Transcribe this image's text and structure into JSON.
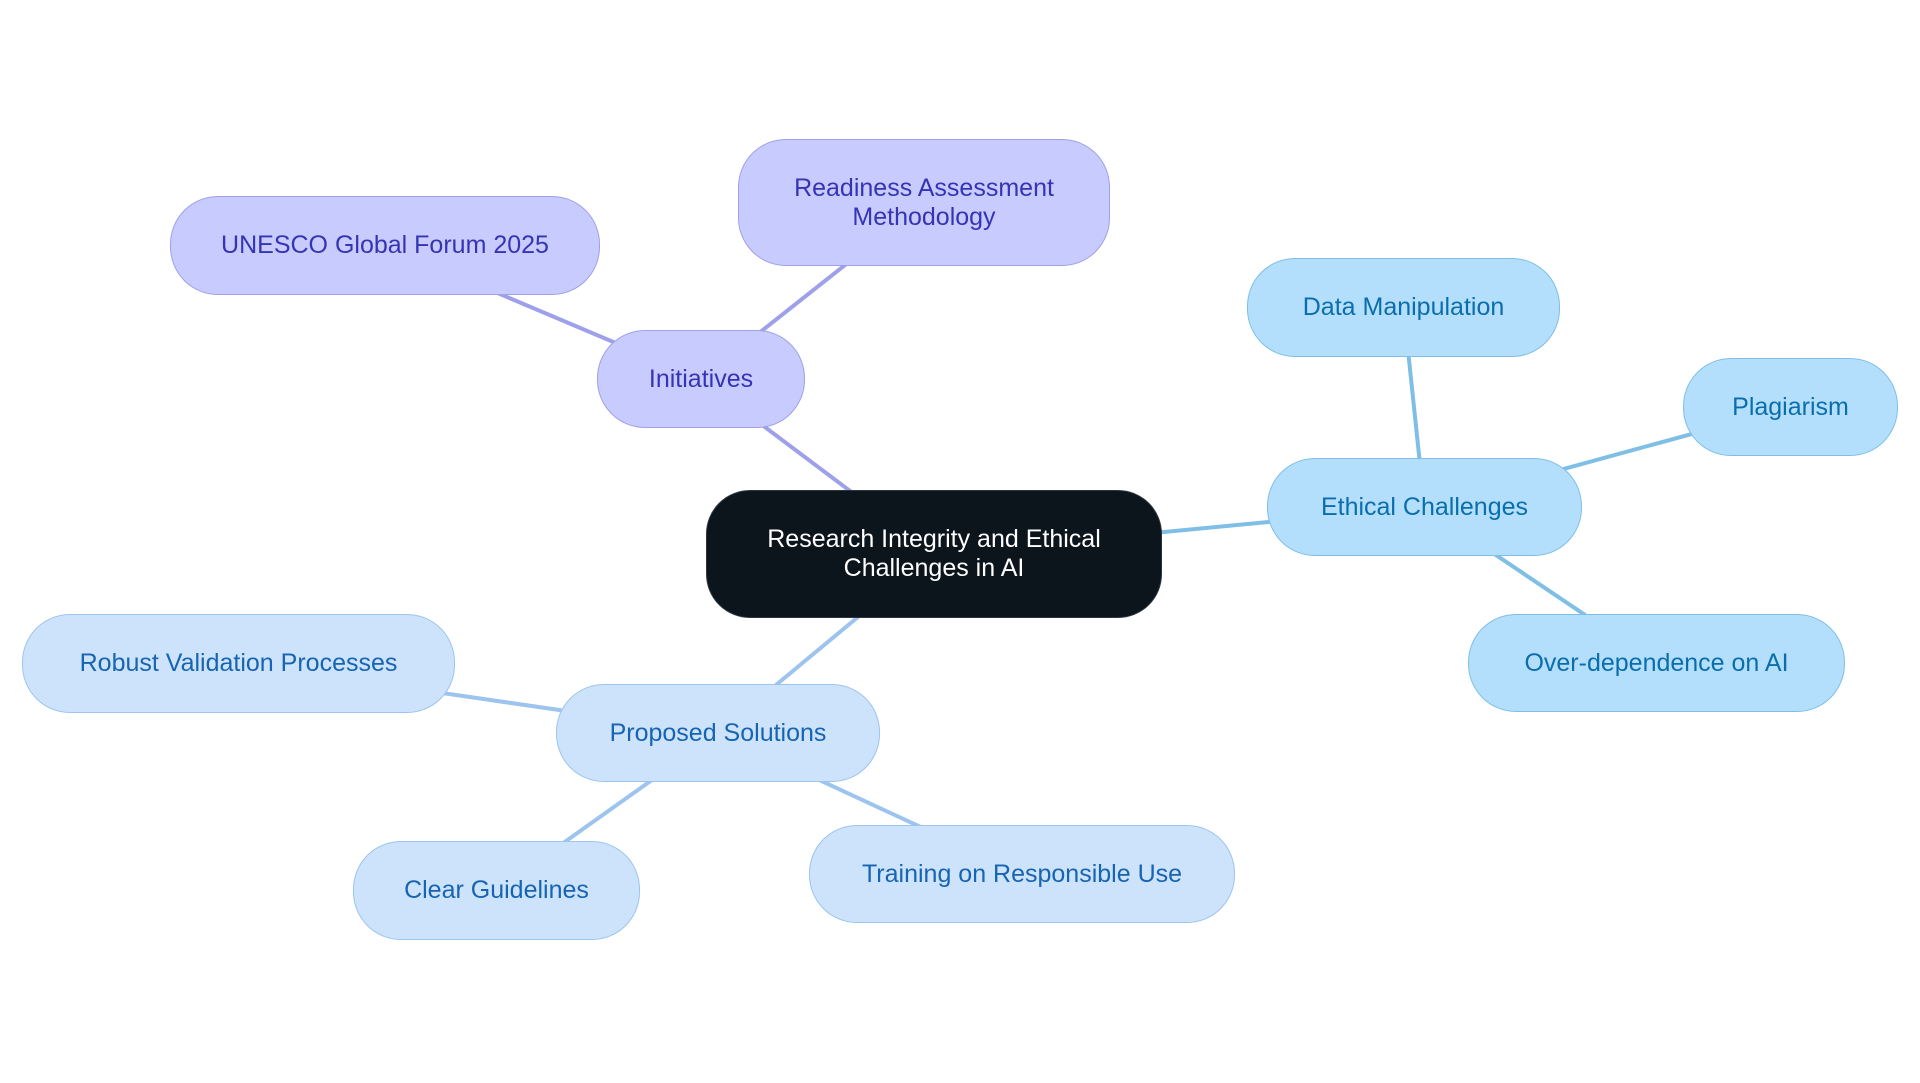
{
  "diagram": {
    "type": "mind-map",
    "root": {
      "id": "root",
      "lines": [
        "Research Integrity and Ethical",
        "Challenges in AI"
      ]
    },
    "branches": [
      {
        "id": "init",
        "label": "Initiatives",
        "color_theme": "purple",
        "children": [
          {
            "id": "unesco",
            "lines": [
              "UNESCO Global Forum 2025"
            ]
          },
          {
            "id": "ready",
            "lines": [
              "Readiness Assessment",
              "Methodology"
            ]
          }
        ]
      },
      {
        "id": "ethic",
        "label": "Ethical Challenges",
        "color_theme": "sky",
        "children": [
          {
            "id": "datam",
            "lines": [
              "Data Manipulation"
            ]
          },
          {
            "id": "plag",
            "lines": [
              "Plagiarism"
            ]
          },
          {
            "id": "over",
            "lines": [
              "Over-dependence on AI"
            ]
          }
        ]
      },
      {
        "id": "prop",
        "label": "Proposed Solutions",
        "color_theme": "pale",
        "children": [
          {
            "id": "robust",
            "lines": [
              "Robust Validation Processes"
            ]
          },
          {
            "id": "clear",
            "lines": [
              "Clear Guidelines"
            ]
          },
          {
            "id": "train",
            "lines": [
              "Training on Responsible Use"
            ]
          }
        ]
      }
    ],
    "edges": [
      {
        "from": "root",
        "to": "init",
        "theme": "purple"
      },
      {
        "from": "init",
        "to": "unesco",
        "theme": "purple"
      },
      {
        "from": "init",
        "to": "ready",
        "theme": "purple"
      },
      {
        "from": "root",
        "to": "ethic",
        "theme": "sky"
      },
      {
        "from": "ethic",
        "to": "datam",
        "theme": "sky"
      },
      {
        "from": "ethic",
        "to": "plag",
        "theme": "sky"
      },
      {
        "from": "ethic",
        "to": "over",
        "theme": "sky"
      },
      {
        "from": "root",
        "to": "prop",
        "theme": "pale"
      },
      {
        "from": "prop",
        "to": "robust",
        "theme": "pale"
      },
      {
        "from": "prop",
        "to": "clear",
        "theme": "pale"
      },
      {
        "from": "prop",
        "to": "train",
        "theme": "pale"
      }
    ],
    "colors": {
      "root_fill": "#0c141c",
      "root_text": "#ffffff",
      "purple_fill": "#c8cbfd",
      "purple_text": "#3534b5",
      "purple_edge": "#9ea1ea",
      "sky_fill": "#b3dffc",
      "sky_text": "#0a6ead",
      "sky_edge": "#7fbfe6",
      "pale_fill": "#cde3fb",
      "pale_text": "#1664b2",
      "pale_edge": "#9cc4ee"
    }
  }
}
